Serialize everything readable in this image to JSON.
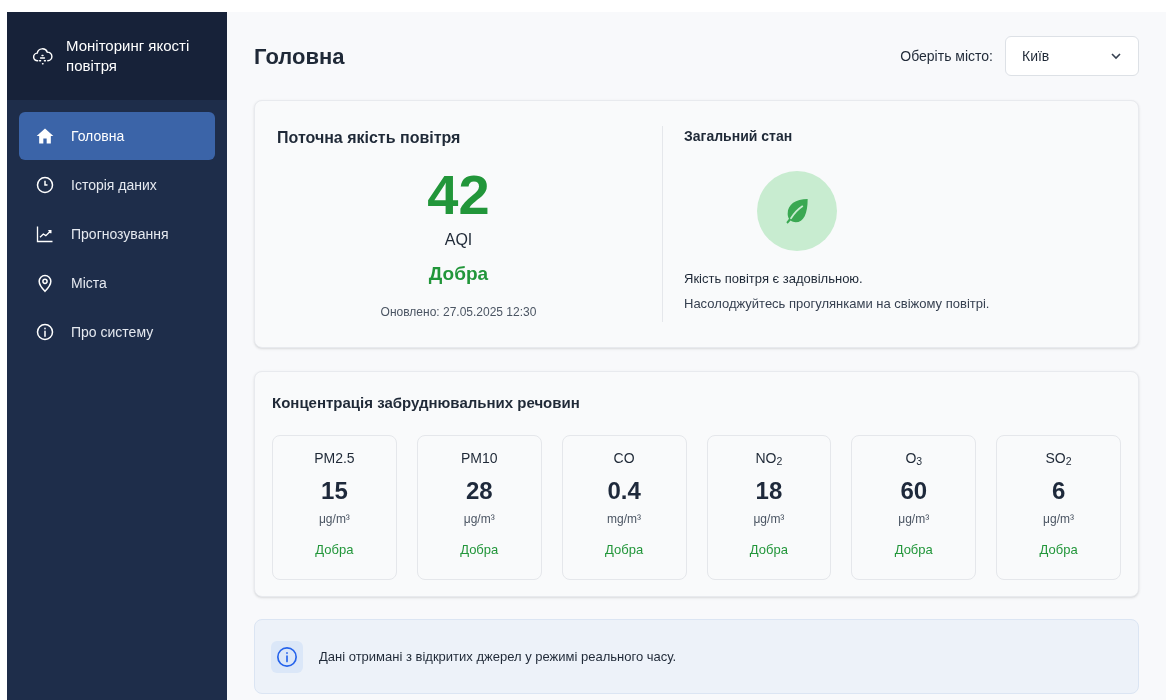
{
  "sidebar": {
    "title": "Моніторинг якості повітря",
    "items": [
      {
        "label": "Головна",
        "selected": true
      },
      {
        "label": "Історія даних",
        "selected": false
      },
      {
        "label": "Прогнозування",
        "selected": false
      },
      {
        "label": "Міста",
        "selected": false
      },
      {
        "label": "Про систему",
        "selected": false
      }
    ]
  },
  "header": {
    "title": "Головна",
    "city_label": "Оберіть місто:",
    "city_select": {
      "value": "Київ"
    }
  },
  "current": {
    "title": "Поточна якість повітря",
    "aqi": "42",
    "aqi_label": "AQI",
    "rating": "Добра",
    "updated": "Оновлено: 27.05.2025 12:30"
  },
  "overall": {
    "title": "Загальний стан",
    "message": "Якість повітря є задовільною.",
    "advice": "Насолоджуйтесь прогулянками на свіжому повітрі."
  },
  "pollutants": {
    "title": "Концентрація забруднювальних речовин",
    "items": [
      {
        "name": "PM2.5",
        "value": "15",
        "unit": "μg/m³",
        "rating": "Добра"
      },
      {
        "name": "PM10",
        "value": "28",
        "unit": "μg/m³",
        "rating": "Добра"
      },
      {
        "name": "CO",
        "value": "0.4",
        "unit": "mg/m³",
        "rating": "Добра"
      },
      {
        "name": "NO$_{2}$",
        "value": "18",
        "unit": "μg/m³",
        "rating": "Добра"
      },
      {
        "name": "O$_{3}$",
        "value": "60",
        "unit": "μg/m³",
        "rating": "Добра"
      },
      {
        "name": "SO$_{2}$",
        "value": "6",
        "unit": "μg/m³",
        "rating": "Добра"
      }
    ]
  },
  "info": {
    "text": "Дані отримані з відкритих джерел у режимі реального часу."
  }
}
